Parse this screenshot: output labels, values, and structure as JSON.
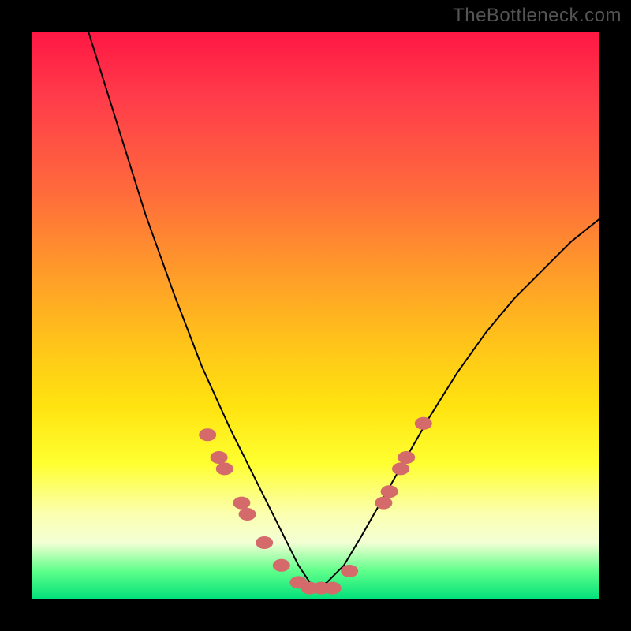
{
  "watermark": "TheBottleneck.com",
  "chart_data": {
    "type": "line",
    "title": "",
    "xlabel": "",
    "ylabel": "",
    "xlim": [
      0,
      100
    ],
    "ylim": [
      0,
      100
    ],
    "grid": false,
    "legend": false,
    "series": [
      {
        "name": "curve",
        "x": [
          10,
          15,
          20,
          25,
          30,
          35,
          38,
          41,
          44,
          47,
          49,
          50,
          52,
          55,
          58,
          62,
          66,
          70,
          75,
          80,
          85,
          90,
          95,
          100
        ],
        "y": [
          100,
          84,
          68,
          54,
          41,
          30,
          24,
          18,
          12,
          6,
          3,
          2,
          3,
          6,
          11,
          18,
          25,
          32,
          40,
          47,
          53,
          58,
          63,
          67
        ]
      }
    ],
    "markers": [
      {
        "x": 31,
        "y": 29
      },
      {
        "x": 33,
        "y": 25
      },
      {
        "x": 34,
        "y": 23
      },
      {
        "x": 37,
        "y": 17
      },
      {
        "x": 38,
        "y": 15
      },
      {
        "x": 41,
        "y": 10
      },
      {
        "x": 44,
        "y": 6
      },
      {
        "x": 47,
        "y": 3
      },
      {
        "x": 49,
        "y": 2
      },
      {
        "x": 51,
        "y": 2
      },
      {
        "x": 53,
        "y": 2
      },
      {
        "x": 56,
        "y": 5
      },
      {
        "x": 62,
        "y": 17
      },
      {
        "x": 63,
        "y": 19
      },
      {
        "x": 65,
        "y": 23
      },
      {
        "x": 66,
        "y": 25
      },
      {
        "x": 69,
        "y": 31
      }
    ],
    "marker_color": "#d46a6a",
    "background_gradient": [
      "#ff1744",
      "#ffff30",
      "#00e07a"
    ]
  }
}
